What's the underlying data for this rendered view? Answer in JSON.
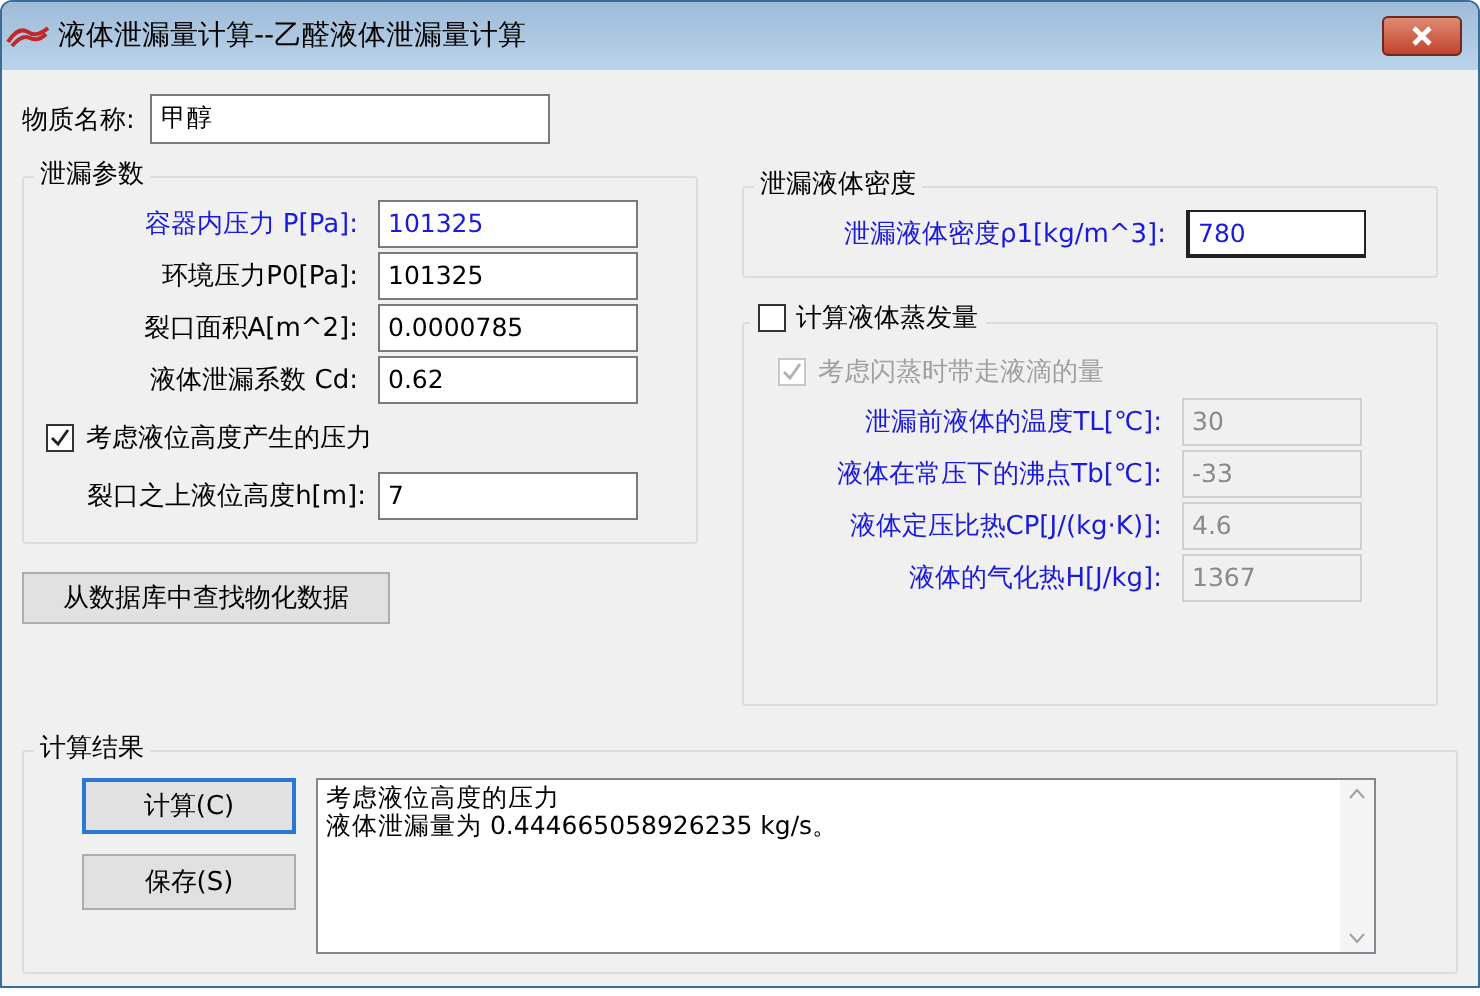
{
  "window": {
    "title": "液体泄漏量计算--乙醛液体泄漏量计算"
  },
  "substance": {
    "label": "物质名称:",
    "value": "甲醇"
  },
  "leak_params": {
    "title": "泄漏参数",
    "fields": [
      {
        "label": "容器内压力 P[Pa]:",
        "value": "101325",
        "highlighted": true
      },
      {
        "label": "环境压力P0[Pa]:",
        "value": "101325",
        "highlighted": false
      },
      {
        "label": "裂口面积A[m^2]:",
        "value": "0.0000785",
        "highlighted": false
      },
      {
        "label": "液体泄漏系数  Cd:",
        "value": "0.62",
        "highlighted": false
      }
    ],
    "level_pressure": {
      "label": "考虑液位高度产生的压力",
      "checked": true
    },
    "height_field": {
      "label": "裂口之上液位高度h[m]:",
      "value": "7",
      "highlighted": false
    }
  },
  "lookup_button": "从数据库中查找物化数据",
  "density": {
    "title": "泄漏液体密度",
    "field": {
      "label": "泄漏液体密度ρ1[kg/m^3]:",
      "value": "780",
      "highlighted": true
    }
  },
  "evaporation": {
    "label": "计算液体蒸发量",
    "checked": false,
    "flash": {
      "label": "考虑闪蒸时带走液滴的量",
      "checked": true,
      "disabled": true
    },
    "fields": [
      {
        "label": "泄漏前液体的温度TL[℃]:",
        "value": "30",
        "highlighted": true,
        "disabled": true
      },
      {
        "label": "液体在常压下的沸点Tb[℃]:",
        "value": "-33",
        "highlighted": true,
        "disabled": true
      },
      {
        "label": "液体定压比热CP[J/(kg·K)]:",
        "value": "4.6",
        "highlighted": true,
        "disabled": true
      },
      {
        "label": "液体的气化热H[J/kg]:",
        "value": "1367",
        "highlighted": true,
        "disabled": true
      }
    ]
  },
  "results": {
    "title": "计算结果",
    "buttons": [
      {
        "label": "计算(C)",
        "selected": true
      },
      {
        "label": "保存(S)",
        "selected": false
      }
    ],
    "output": [
      "考虑液位高度的压力",
      "液体泄漏量为 0.444665058926235 kg/s。"
    ]
  }
}
